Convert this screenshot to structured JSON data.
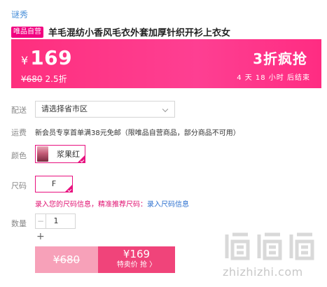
{
  "brand": "谜秀",
  "product": {
    "badge": "唯品自营",
    "title": "羊毛混纺小香风毛衣外套加厚针织开衫上衣女"
  },
  "price": {
    "currency": "¥",
    "current": "169",
    "original": "¥680",
    "discount": "2.5折",
    "promo_title": "3折疯抢",
    "promo_timer": "4 天 18 小时 后结束"
  },
  "delivery": {
    "label": "配送",
    "placeholder": "请选择省市区"
  },
  "shipping": {
    "label": "运费",
    "text": "新会员专享首单满38元免邮（限唯品自营商品，部分商品不可用）"
  },
  "color": {
    "label": "颜色",
    "selected": "浆果红"
  },
  "size": {
    "label": "尺码",
    "selected": "F",
    "tip": "录入您的尺码信息，精准推荐尺码：",
    "tip_link": "录入尺码信息"
  },
  "quantity": {
    "label": "数量",
    "minus": "−",
    "value": "1",
    "plus": "+"
  },
  "buy": {
    "original_price": "¥680",
    "sale_price": "¥169",
    "sale_label": "特卖价 抢 〉"
  },
  "watermark": {
    "text": "zhizhizhi.com"
  },
  "colors": {
    "accent": "#f10180",
    "banner": "#fe3f92",
    "link": "#2b6fcf",
    "brand": "#4a90d9"
  }
}
